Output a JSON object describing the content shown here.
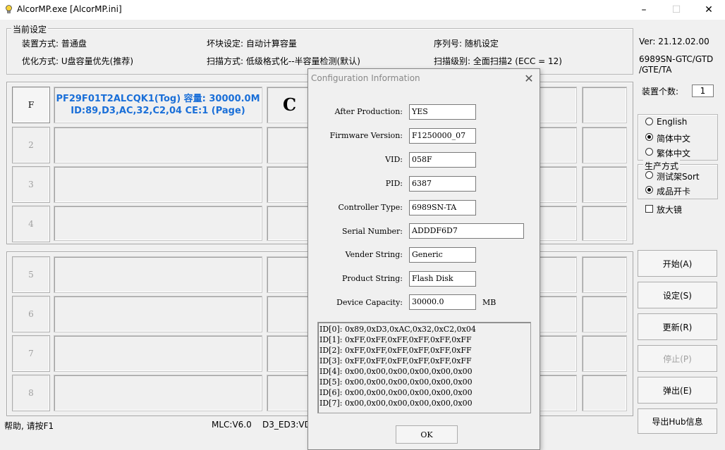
{
  "window": {
    "title": "AlcorMP.exe [AlcorMP.ini]",
    "minimize": "–",
    "maximize": "☐",
    "close": "✕"
  },
  "settings": {
    "group_title": "当前设定",
    "mount_mode": "装置方式: 普通盘",
    "bad_block": "坏块设定: 自动计算容量",
    "serial": "序列号: 随机设定",
    "optimize": "优化方式: U盘容量优先(推荐)",
    "scan_mode": "扫描方式: 低级格式化--半容量检测(默认)",
    "scan_level": "扫描级别: 全面扫描2 (ECC = 12)"
  },
  "ports": {
    "group1": [
      "F",
      "2",
      "3",
      "4"
    ],
    "group2": [
      "5",
      "6",
      "7",
      "8"
    ],
    "port1_info_line1": "PF29F01T2ALCQK1(Tog) 容量: 30000.0M",
    "port1_info_line2": "ID:89,D3,AC,32,C2,04 CE:1 (Page)",
    "port1_drive": "C"
  },
  "right_panel": {
    "version": "Ver: 21.12.02.00",
    "chip_line1": "6989SN-GTC/GTD",
    "chip_line2": "/GTE/TA",
    "device_count_label": "装置个数:",
    "device_count": "1",
    "lang_english": "English",
    "lang_simplified": "简体中文",
    "lang_traditional": "繁体中文",
    "prod_group_title": "生产方式",
    "prod_test": "测试架Sort",
    "prod_card": "成品开卡",
    "magnifier": "放大镜",
    "btn_start": "开始(A)",
    "btn_settings": "设定(S)",
    "btn_refresh": "更新(R)",
    "btn_stop": "停止(P)",
    "btn_eject": "弹出(E)",
    "btn_export": "导出Hub信息"
  },
  "status": {
    "help": "帮助, 请按F1",
    "mlc": "MLC:V6.0",
    "d3": "D3_ED3:VD"
  },
  "dialog": {
    "title": "Configuration Information",
    "fields": [
      {
        "label": "After Production:",
        "value": "YES"
      },
      {
        "label": "Firmware Version:",
        "value": "F1250000_07"
      },
      {
        "label": "VID:",
        "value": "058F"
      },
      {
        "label": "PID:",
        "value": "6387"
      },
      {
        "label": "Controller Type:",
        "value": "6989SN-TA"
      },
      {
        "label": "Serial Number:",
        "value": "ADDDF6D7"
      },
      {
        "label": "Vender String:",
        "value": "Generic"
      },
      {
        "label": "Product String:",
        "value": "Flash Disk"
      },
      {
        "label": "Device Capacity:",
        "value": "30000.0"
      }
    ],
    "capacity_unit": "MB",
    "ids": [
      "ID[0]: 0x89,0xD3,0xAC,0x32,0xC2,0x04",
      "ID[1]: 0xFF,0xFF,0xFF,0xFF,0xFF,0xFF",
      "ID[2]: 0xFF,0xFF,0xFF,0xFF,0xFF,0xFF",
      "ID[3]: 0xFF,0xFF,0xFF,0xFF,0xFF,0xFF",
      "ID[4]: 0x00,0x00,0x00,0x00,0x00,0x00",
      "ID[5]: 0x00,0x00,0x00,0x00,0x00,0x00",
      "ID[6]: 0x00,0x00,0x00,0x00,0x00,0x00",
      "ID[7]: 0x00,0x00,0x00,0x00,0x00,0x00"
    ],
    "ok": "OK"
  }
}
